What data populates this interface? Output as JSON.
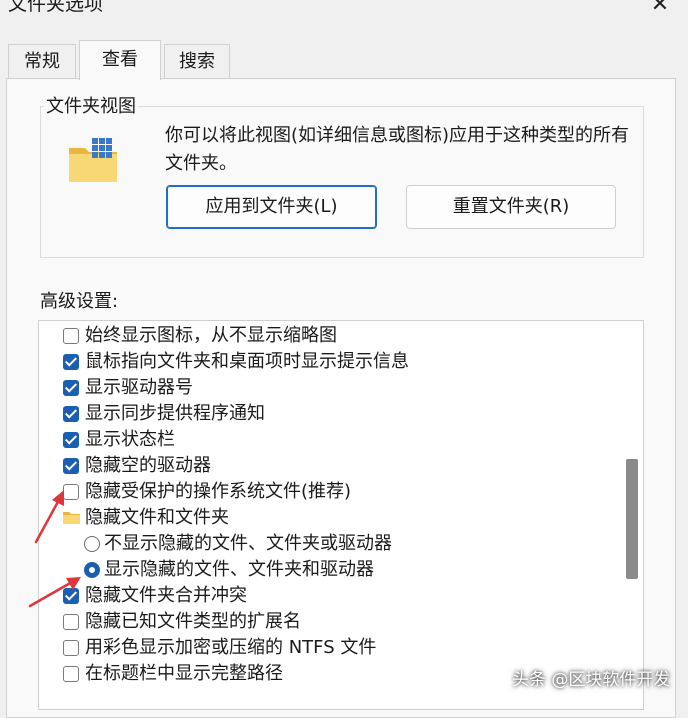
{
  "window": {
    "title": "文件夹选项",
    "close_glyph": "✕"
  },
  "tabs": [
    {
      "label": "常规",
      "active": false
    },
    {
      "label": "查看",
      "active": true
    },
    {
      "label": "搜索",
      "active": false
    }
  ],
  "folder_view": {
    "group_label": "文件夹视图",
    "icon": "folder-grid-icon",
    "description": "你可以将此视图(如详细信息或图标)应用于这种类型的所有文件夹。",
    "apply_button": "应用到文件夹(L)",
    "reset_button": "重置文件夹(R)"
  },
  "advanced": {
    "label": "高级设置:",
    "items": [
      {
        "type": "checkbox",
        "checked": false,
        "label": "始终显示图标，从不显示缩略图"
      },
      {
        "type": "checkbox",
        "checked": true,
        "label": "鼠标指向文件夹和桌面项时显示提示信息"
      },
      {
        "type": "checkbox",
        "checked": true,
        "label": "显示驱动器号"
      },
      {
        "type": "checkbox",
        "checked": true,
        "label": "显示同步提供程序通知"
      },
      {
        "type": "checkbox",
        "checked": true,
        "label": "显示状态栏"
      },
      {
        "type": "checkbox",
        "checked": true,
        "label": "隐藏空的驱动器"
      },
      {
        "type": "checkbox",
        "checked": false,
        "label": "隐藏受保护的操作系统文件(推荐)"
      },
      {
        "type": "folder",
        "label": "隐藏文件和文件夹"
      },
      {
        "type": "radio",
        "checked": false,
        "label": "不显示隐藏的文件、文件夹或驱动器"
      },
      {
        "type": "radio",
        "checked": true,
        "label": "显示隐藏的文件、文件夹和驱动器"
      },
      {
        "type": "checkbox",
        "checked": true,
        "label": "隐藏文件夹合并冲突"
      },
      {
        "type": "checkbox",
        "checked": false,
        "label": "隐藏已知文件类型的扩展名"
      },
      {
        "type": "checkbox",
        "checked": false,
        "label": "用彩色显示加密或压缩的 NTFS 文件"
      },
      {
        "type": "checkbox",
        "checked": false,
        "label": "在标题栏中显示完整路径"
      }
    ]
  },
  "watermark": "头条 @区块软件开发",
  "colors": {
    "accent": "#1b5fb0",
    "annotation_arrow": "#e0353a"
  }
}
